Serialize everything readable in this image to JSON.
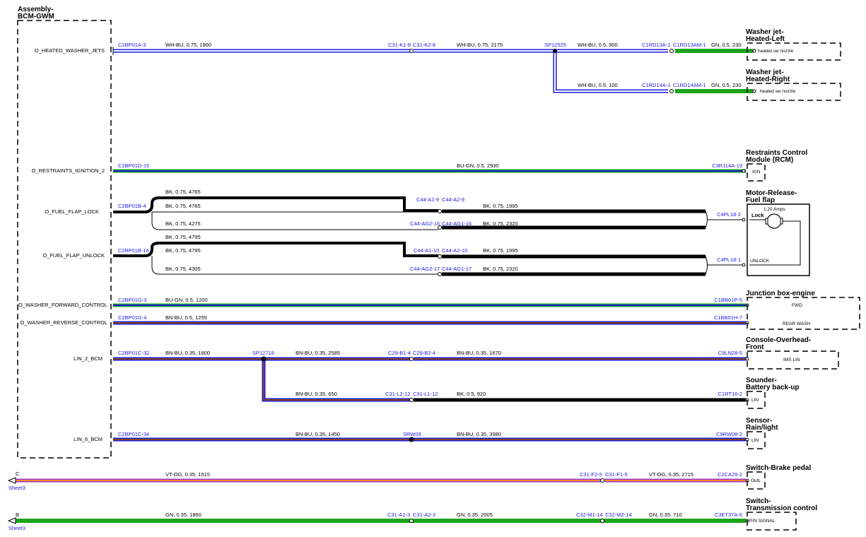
{
  "assembly": {
    "title_line1": "Assembly-",
    "title_line2": "BCM-GWM"
  },
  "signals": {
    "heated_washer": "O_HEATED_WASHER_JETS",
    "restraints": "O_RESTRAINTS_IGNITION_2",
    "fuel_lock": "O_FUEL_FLAP_LOCK",
    "fuel_unlock": "O_FUEL_FLAP_UNLOCK",
    "washer_fwd": "O_WASHER_FORWARD_CONTROL",
    "washer_rev": "O_WASHER_REVERSE_CONTROL",
    "lin2": "LIN_2_BCM",
    "lin6": "LIN_6_BCM"
  },
  "components": {
    "washer_left": {
      "title1": "Washer jet-",
      "title2": "Heated-Left",
      "pin_label": "heated sw nozzle"
    },
    "washer_right": {
      "title1": "Washer jet-",
      "title2": "Heated-Right",
      "pin_label": "heated sw nozzle"
    },
    "rcm": {
      "title1": "Restraints Control",
      "title2": "Module (RCM)",
      "pin_label": "IGN"
    },
    "fuel_flap": {
      "title1": "Motor-Release-",
      "title2": "Fuel flap",
      "rating": "1.20 Amps",
      "lock": "Lock",
      "unlock": "UNLOCK"
    },
    "junction": {
      "title": "Junction box-engine",
      "fwd": "FWD",
      "rear": "REAR WASH"
    },
    "console": {
      "title1": "Console-Overhead-",
      "title2": "Front",
      "pin_label": "IMS LIN"
    },
    "sounder": {
      "title1": "Sounder-",
      "title2": "Battery back-up",
      "pin_label": "LIN"
    },
    "rain": {
      "title1": "Sensor-",
      "title2": "Rain/light",
      "pin_label": "LIN"
    },
    "brake": {
      "title": "Switch-Brake pedal",
      "pin_label": "OutL"
    },
    "trans": {
      "title1": "Switch-",
      "title2": "Transmission control",
      "pin_label": "P/N SIGNAL"
    }
  },
  "pins": {
    "p1": "C2BP01A-3",
    "p2": "C31-K1-8",
    "p3": "C31-K2-8",
    "p4": "SP12525",
    "p5": "C1RD13A-1",
    "p6": "C1RD13AM-1",
    "p7": "C1RD14A-1",
    "p8": "C1RD14AM-1",
    "p9": "C2BP01D-15",
    "p10": "C3R114A-19",
    "p11": "C2BP01B-4",
    "p12": "C44-A1-9",
    "p13": "C44-A2-9",
    "p14": "C44-AG2-16",
    "p15": "C44-AG1-16",
    "p16": "C4PL18-2",
    "p17": "C2BP01B-16",
    "p18": "C44-A1-10",
    "p19": "C44-A2-10",
    "p20": "C44-AG2-17",
    "p21": "C44-AG1-17",
    "p22": "C4PL18-1",
    "p23": "C2BP01G-3",
    "p24": "C1BB01P-5",
    "p25": "C2BP01G-4",
    "p26": "C1BB01H-7",
    "p27": "C2BP01C-32",
    "p28": "SP12718",
    "p29": "C29-B1-4",
    "p30": "C29-B2-4",
    "p31": "C9LN28-5",
    "p32": "C31-L2-12",
    "p33": "C31-L1-12",
    "p34": "C1RT16-2",
    "p35": "C2BP01C-34",
    "p36": "SRW09",
    "p37": "C9RW08-2",
    "p38": "C31-F2-5",
    "p39": "C31-F1-5",
    "p40": "C2CA29-2",
    "p41": "C31-A1-3",
    "p42": "C31-A2-3",
    "p43": "C32-M1-14",
    "p44": "C32-M2-14",
    "p45": "C3ET37A-6"
  },
  "wires": {
    "w1": "WH-BU,  0.75,  1900",
    "w2": "WH-BU,  0.75,  2175",
    "w3": "WH-BU,  0.5,  900",
    "w4": "GN,  0.5,  230",
    "w5": "WH-BU,  0.5,  100",
    "w6": "GN,  0.5,  230",
    "w7": "BU-GN,  0.5,  2930",
    "w8": "BK,  0.75,  4765",
    "w9": "BK,  0.75,  4765",
    "w10": "BK,  0.75,  1995",
    "w11": "BK,  0.75,  4275",
    "w12": "BK,  0.75,  2320",
    "w13": "BK,  0.75,  4795",
    "w14": "BK,  0.75,  4795",
    "w15": "BK,  0.75,  1995",
    "w16": "BK,  0.75,  4305",
    "w17": "BK,  0.75,  2320",
    "w18": "BU-GN,  0.5,  1200",
    "w19": "BN-BU,  0.5,  1255",
    "w20": "BN-BU,  0.35,  1800",
    "w21": "BN-BU,  0.35,  2585",
    "w22": "BN-BU,  0.35,  1670",
    "w23": "BN-BU,  0.35,  650",
    "w24": "BK,  0.5,  920",
    "w25": "BN-BU,  0.35,  1450",
    "w26": "BN-BU,  0.35,  3980",
    "w27": "VT-OG,  0.35,  1515",
    "w28": "VT-OG,  0.35,  2715",
    "w29": "GN,  0.35,  1860",
    "w30": "GN,  0.35,  2005",
    "w31": "GN,  0.35,  710"
  },
  "offsheet": {
    "c_letter": "C",
    "c_sheet": "Sheet3",
    "b_letter": "B",
    "b_sheet": "Sheet3"
  },
  "colors": {
    "WH-BU": [
      "#ffffff",
      "#1a1ae0"
    ],
    "GN": [
      "#1aa51a"
    ],
    "BU-GN": [
      "#1a1ae0",
      "#1aa51a"
    ],
    "BK": [
      "#000000"
    ],
    "BN-BU": [
      "#8b4513",
      "#1a1ae0"
    ],
    "VT-OG": [
      "#9b30d0",
      "#ff8c1a"
    ],
    "pin_text": "#1a1ae0"
  }
}
